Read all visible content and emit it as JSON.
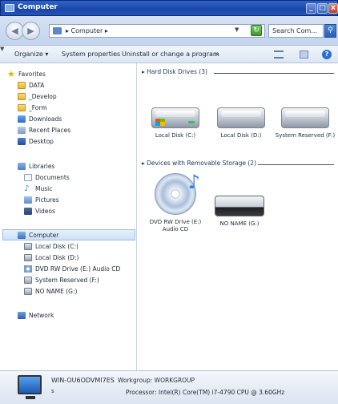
{
  "window": {
    "title": "Computer"
  },
  "address": {
    "path": "▸ Computer ▸",
    "search_placeholder": "Search Com..."
  },
  "toolbar": {
    "organize": "Organize ▾",
    "system_properties": "System properties",
    "uninstall": "Uninstall or change a program",
    "more": "»"
  },
  "sidebar": {
    "favorites": [
      {
        "label": "Favorites",
        "icon": "star-icon"
      },
      {
        "label": "DATA",
        "icon": "folder-icon"
      },
      {
        "label": "_Develop",
        "icon": "folder-icon"
      },
      {
        "label": "_Form",
        "icon": "folder-icon"
      },
      {
        "label": "Downloads",
        "icon": "downloads-icon"
      },
      {
        "label": "Recent Places",
        "icon": "recent-places-icon"
      },
      {
        "label": "Desktop",
        "icon": "desktop-icon"
      }
    ],
    "libraries": [
      {
        "label": "Libraries",
        "icon": "libraries-icon"
      },
      {
        "label": "Documents",
        "icon": "documents-icon"
      },
      {
        "label": "Music",
        "icon": "music-icon"
      },
      {
        "label": "Pictures",
        "icon": "pictures-icon"
      },
      {
        "label": "Videos",
        "icon": "videos-icon"
      }
    ],
    "computer": [
      {
        "label": "Computer",
        "icon": "computer-icon"
      },
      {
        "label": "Local Disk (C:)",
        "icon": "drive-icon"
      },
      {
        "label": "Local Disk (D:)",
        "icon": "drive-icon"
      },
      {
        "label": "DVD RW Drive (E:) Audio CD",
        "icon": "cd-icon"
      },
      {
        "label": "System Reserved (F:)",
        "icon": "drive-icon"
      },
      {
        "label": "NO NAME (G:)",
        "icon": "drive-icon"
      }
    ],
    "network": {
      "label": "Network",
      "icon": "network-icon"
    }
  },
  "content": {
    "hdd_header": "Hard Disk Drives (3)",
    "hard_drives": [
      "Local Disk (C:)",
      "Local Disk (D:)",
      "System Reserved (F:)"
    ],
    "removable_header": "Devices with Removable Storage (2)",
    "removable": [
      "DVD RW Drive (E:) Audio CD",
      "NO NAME (G:)"
    ]
  },
  "details": {
    "computer_name": "WIN-OU6ODVMI7ES",
    "workgroup": "Workgroup: WORKGROUP",
    "processor": "Processor: Intel(R) Core(TM) i7-4790 CPU @ 3.60GHz",
    "separator": "s"
  },
  "colors": {
    "title_bar": "#1b46a8",
    "selection": "#cfe1f6",
    "accent": "#2d6fce"
  }
}
